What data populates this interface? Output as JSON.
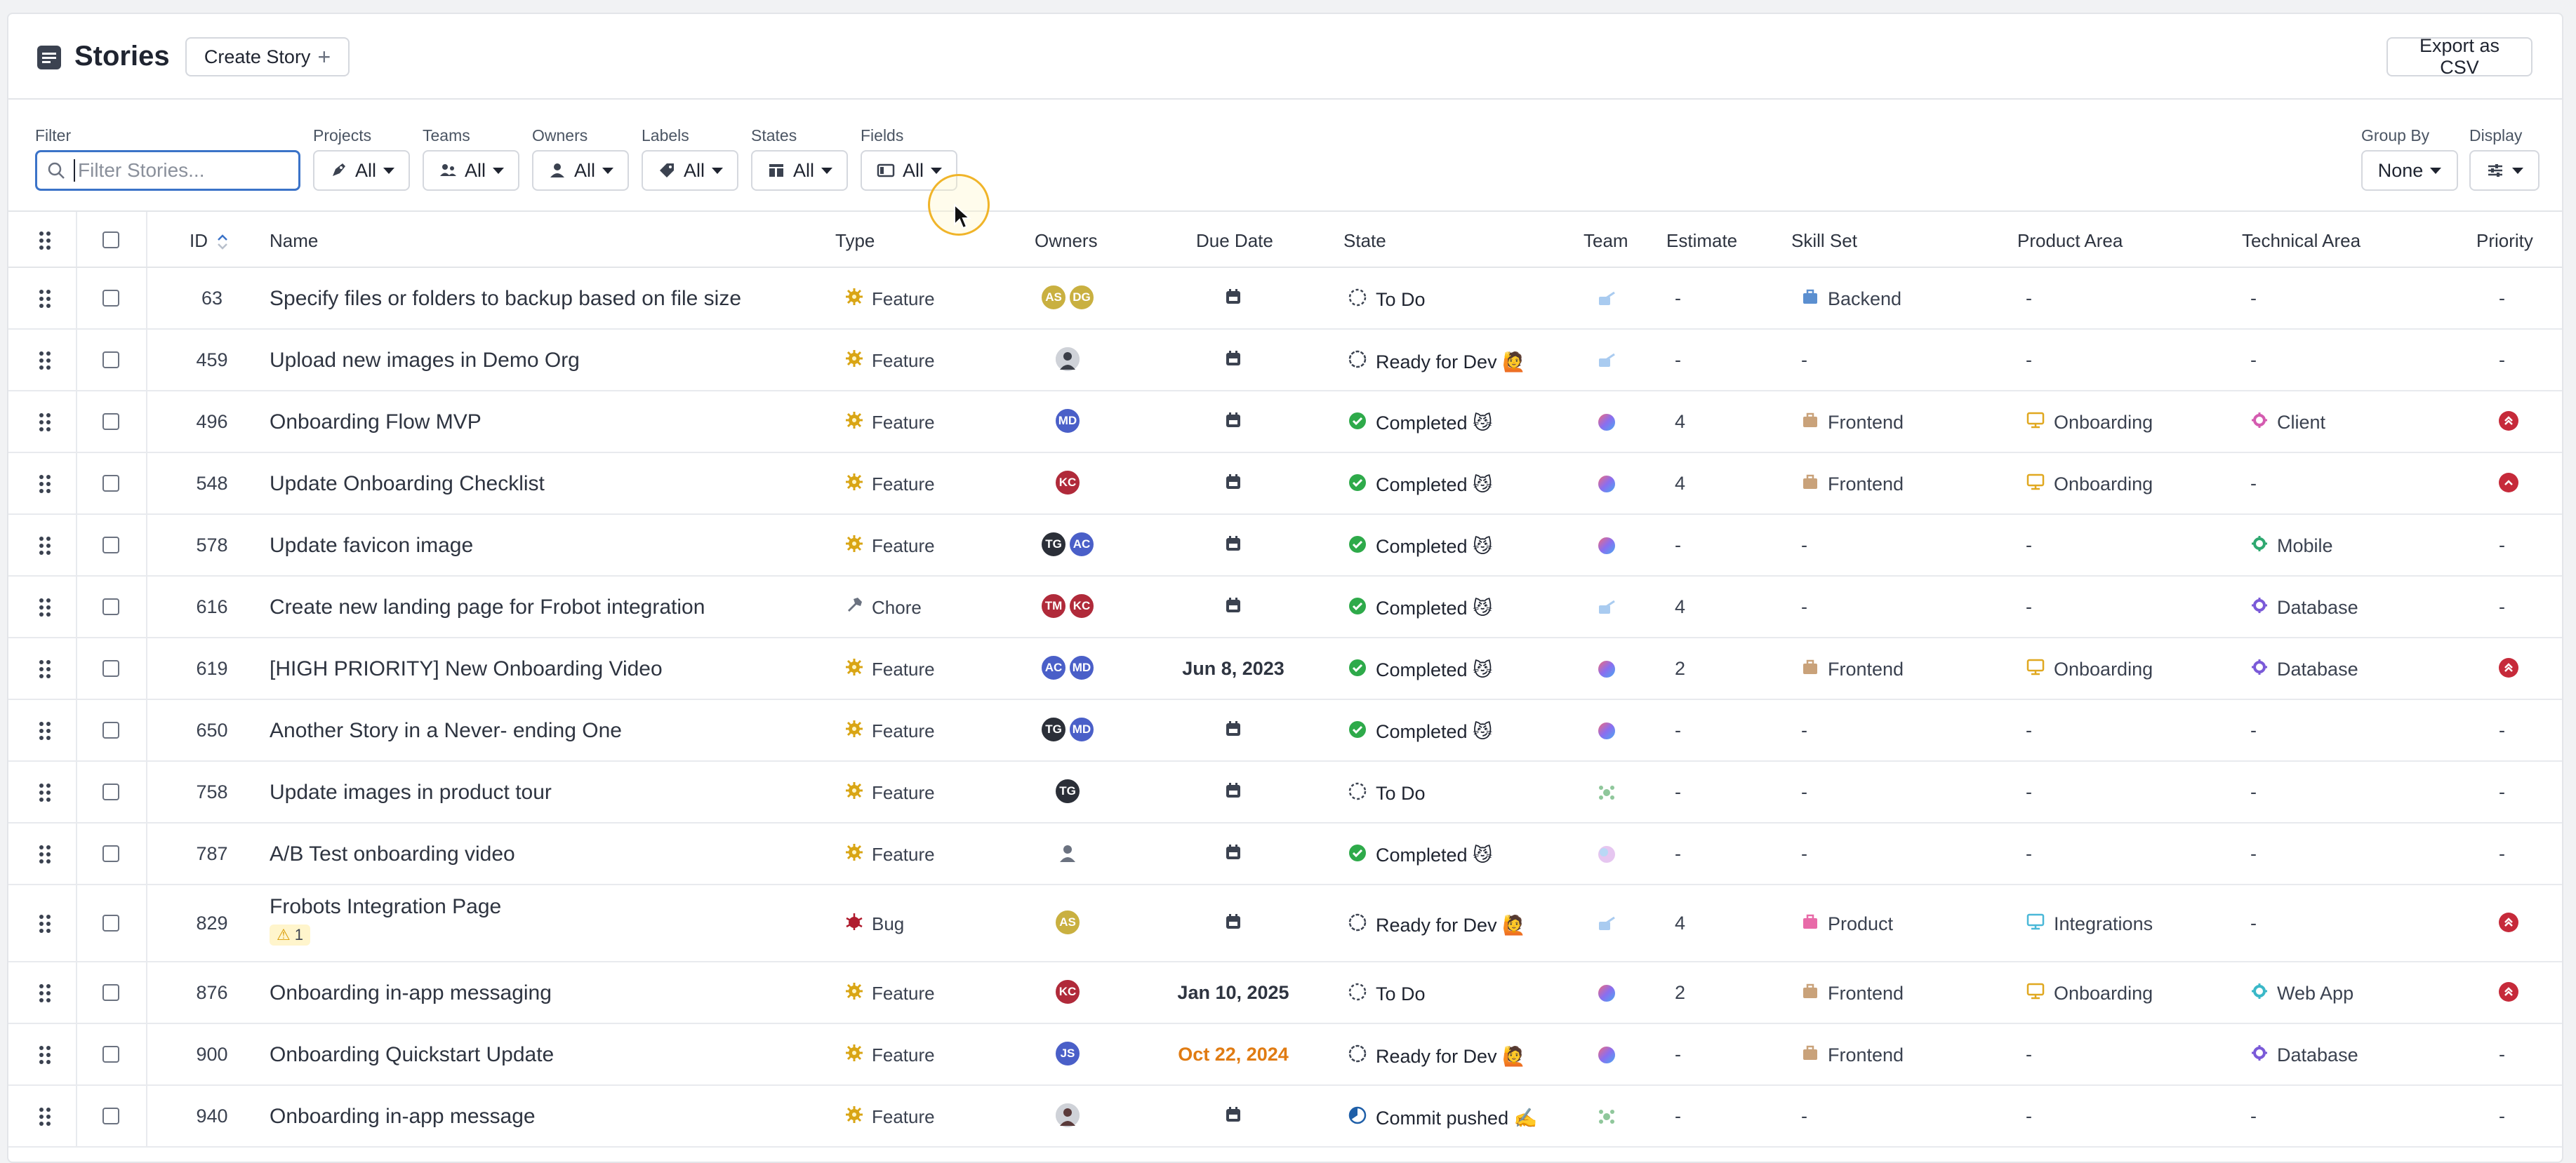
{
  "header": {
    "title": "Stories",
    "create_label": "Create Story",
    "export_label": "Export as CSV"
  },
  "filters": {
    "filter_label": "Filter",
    "search_placeholder": "Filter Stories...",
    "projects": {
      "label": "Projects",
      "value": "All"
    },
    "teams": {
      "label": "Teams",
      "value": "All"
    },
    "owners": {
      "label": "Owners",
      "value": "All"
    },
    "labels": {
      "label": "Labels",
      "value": "All"
    },
    "states": {
      "label": "States",
      "value": "All"
    },
    "fields": {
      "label": "Fields",
      "value": "All"
    },
    "group_by": {
      "label": "Group By",
      "value": "None"
    },
    "display": {
      "label": "Display"
    }
  },
  "columns": {
    "id": "ID",
    "name": "Name",
    "type": "Type",
    "owners": "Owners",
    "due": "Due Date",
    "state": "State",
    "team": "Team",
    "estimate": "Estimate",
    "skill": "Skill Set",
    "product": "Product Area",
    "technical": "Technical Area",
    "priority": "Priority"
  },
  "colors": {
    "accent": "#3b73c8",
    "feature": "#d9a514",
    "completed": "#2eaa4a",
    "priority": "#c62a3a",
    "due_warning": "#e07b12"
  },
  "rows": [
    {
      "id": "63",
      "name": "Specify files or folders to backup based on file size",
      "type": "Feature",
      "type_icon": "feature-icon",
      "owners": [
        {
          "i": "AS",
          "c": "#c9b040"
        },
        {
          "i": "DG",
          "c": "#c9b040"
        }
      ],
      "due": "",
      "state": "To Do",
      "state_icon": "todo-icon",
      "team": "team-a-icon",
      "estimate": "-",
      "skill": "Backend",
      "skill_icon": "skill-backend-icon",
      "product": "-",
      "product_icon": "",
      "technical": "-",
      "technical_icon": "",
      "priority": "-"
    },
    {
      "id": "459",
      "name": "Upload new images in Demo Org",
      "type": "Feature",
      "type_icon": "feature-icon",
      "owners": [
        {
          "i": "",
          "c": "#3b3f48",
          "photo": true
        }
      ],
      "due": "",
      "state": "Ready for Dev 🙋",
      "state_icon": "ready-icon",
      "team": "team-a-icon",
      "estimate": "-",
      "skill": "-",
      "skill_icon": "",
      "product": "-",
      "product_icon": "",
      "technical": "-",
      "technical_icon": "",
      "priority": "-"
    },
    {
      "id": "496",
      "name": "Onboarding Flow MVP",
      "type": "Feature",
      "type_icon": "feature-icon",
      "owners": [
        {
          "i": "MD",
          "c": "#4a5fc8"
        }
      ],
      "due": "",
      "state": "Completed 😼",
      "state_icon": "completed-icon",
      "team": "team-b-icon",
      "estimate": "4",
      "skill": "Frontend",
      "skill_icon": "skill-frontend-icon",
      "product": "Onboarding",
      "product_icon": "product-onboarding-icon",
      "technical": "Client",
      "technical_icon": "tech-client-icon",
      "priority": "highest"
    },
    {
      "id": "548",
      "name": "Update Onboarding Checklist",
      "type": "Feature",
      "type_icon": "feature-icon",
      "owners": [
        {
          "i": "KC",
          "c": "#b02a3a"
        }
      ],
      "due": "",
      "state": "Completed 😼",
      "state_icon": "completed-icon",
      "team": "team-b-icon",
      "estimate": "4",
      "skill": "Frontend",
      "skill_icon": "skill-frontend-icon",
      "product": "Onboarding",
      "product_icon": "product-onboarding-icon",
      "technical": "-",
      "technical_icon": "",
      "priority": "high"
    },
    {
      "id": "578",
      "name": "Update favicon image",
      "type": "Feature",
      "type_icon": "feature-icon",
      "owners": [
        {
          "i": "TG",
          "c": "#2b2f38"
        },
        {
          "i": "AC",
          "c": "#4a5fc8"
        }
      ],
      "due": "",
      "state": "Completed 😼",
      "state_icon": "completed-icon",
      "team": "team-b-icon",
      "estimate": "-",
      "skill": "-",
      "skill_icon": "",
      "product": "-",
      "product_icon": "",
      "technical": "Mobile",
      "technical_icon": "tech-mobile-icon",
      "priority": "-"
    },
    {
      "id": "616",
      "name": "Create new landing page for Frobot integration",
      "type": "Chore",
      "type_icon": "chore-icon",
      "owners": [
        {
          "i": "TM",
          "c": "#b02a3a"
        },
        {
          "i": "KC",
          "c": "#b02a3a"
        }
      ],
      "due": "",
      "state": "Completed 😼",
      "state_icon": "completed-icon",
      "team": "team-a-icon",
      "estimate": "4",
      "skill": "-",
      "skill_icon": "",
      "product": "-",
      "product_icon": "",
      "technical": "Database",
      "technical_icon": "tech-database-icon",
      "priority": "-"
    },
    {
      "id": "619",
      "name": "[HIGH PRIORITY] New Onboarding Video",
      "type": "Feature",
      "type_icon": "feature-icon",
      "owners": [
        {
          "i": "AC",
          "c": "#4a5fc8"
        },
        {
          "i": "MD",
          "c": "#4a5fc8"
        }
      ],
      "due": "Jun 8, 2023",
      "state": "Completed 😼",
      "state_icon": "completed-icon",
      "team": "team-b-icon",
      "estimate": "2",
      "skill": "Frontend",
      "skill_icon": "skill-frontend-icon",
      "product": "Onboarding",
      "product_icon": "product-onboarding-icon",
      "technical": "Database",
      "technical_icon": "tech-database-icon",
      "priority": "highest"
    },
    {
      "id": "650",
      "name": "Another Story in a Never- ending One",
      "type": "Feature",
      "type_icon": "feature-icon",
      "owners": [
        {
          "i": "TG",
          "c": "#2b2f38"
        },
        {
          "i": "MD",
          "c": "#4a5fc8"
        }
      ],
      "due": "",
      "state": "Completed 😼",
      "state_icon": "completed-icon",
      "team": "team-b-icon",
      "estimate": "-",
      "skill": "-",
      "skill_icon": "",
      "product": "-",
      "product_icon": "",
      "technical": "-",
      "technical_icon": "",
      "priority": "-"
    },
    {
      "id": "758",
      "name": "Update images in product tour",
      "type": "Feature",
      "type_icon": "feature-icon",
      "owners": [
        {
          "i": "TG",
          "c": "#2b2f38"
        }
      ],
      "due": "",
      "state": "To Do",
      "state_icon": "todo-icon",
      "team": "team-c-icon",
      "estimate": "-",
      "skill": "-",
      "skill_icon": "",
      "product": "-",
      "product_icon": "",
      "technical": "-",
      "technical_icon": "",
      "priority": "-"
    },
    {
      "id": "787",
      "name": "A/B Test onboarding video",
      "type": "Feature",
      "type_icon": "feature-icon",
      "owners": [
        {
          "i": "",
          "c": "#ffffff",
          "generic": true
        }
      ],
      "due": "",
      "state": "Completed 😼",
      "state_icon": "completed-icon",
      "team": "team-d-icon",
      "estimate": "-",
      "skill": "-",
      "skill_icon": "",
      "product": "-",
      "product_icon": "",
      "technical": "-",
      "technical_icon": "",
      "priority": "-"
    },
    {
      "id": "829",
      "name": "Frobots Integration Page",
      "warning": "1",
      "type": "Bug",
      "type_icon": "bug-icon",
      "owners": [
        {
          "i": "AS",
          "c": "#c9b040"
        }
      ],
      "due": "",
      "state": "Ready for Dev 🙋",
      "state_icon": "ready-icon",
      "team": "team-a-icon",
      "estimate": "4",
      "skill": "Product",
      "skill_icon": "skill-product-icon",
      "product": "Integrations",
      "product_icon": "product-integrations-icon",
      "technical": "-",
      "technical_icon": "",
      "priority": "highest"
    },
    {
      "id": "876",
      "name": "Onboarding in-app messaging",
      "type": "Feature",
      "type_icon": "feature-icon",
      "owners": [
        {
          "i": "KC",
          "c": "#b02a3a"
        }
      ],
      "due": "Jan 10, 2025",
      "state": "To Do",
      "state_icon": "todo-icon",
      "team": "team-b-icon",
      "estimate": "2",
      "skill": "Frontend",
      "skill_icon": "skill-frontend-icon",
      "product": "Onboarding",
      "product_icon": "product-onboarding-icon",
      "technical": "Web App",
      "technical_icon": "tech-webapp-icon",
      "priority": "highest"
    },
    {
      "id": "900",
      "name": "Onboarding Quickstart Update",
      "type": "Feature",
      "type_icon": "feature-icon",
      "owners": [
        {
          "i": "JS",
          "c": "#4a5fc8"
        }
      ],
      "due": "Oct 22, 2024",
      "due_warning": true,
      "state": "Ready for Dev 🙋",
      "state_icon": "ready-icon",
      "team": "team-b-icon",
      "estimate": "-",
      "skill": "Frontend",
      "skill_icon": "skill-frontend-icon",
      "product": "-",
      "product_icon": "",
      "technical": "Database",
      "technical_icon": "tech-database-icon",
      "priority": "-"
    },
    {
      "id": "940",
      "name": "Onboarding in-app message",
      "type": "Feature",
      "type_icon": "feature-icon",
      "owners": [
        {
          "i": "",
          "c": "#5a3a3a",
          "photo": true
        }
      ],
      "due": "",
      "state": "Commit pushed ✍️",
      "state_icon": "commit-icon",
      "team": "team-c-icon",
      "estimate": "-",
      "skill": "-",
      "skill_icon": "",
      "product": "-",
      "product_icon": "",
      "technical": "-",
      "technical_icon": "",
      "priority": "-"
    }
  ]
}
